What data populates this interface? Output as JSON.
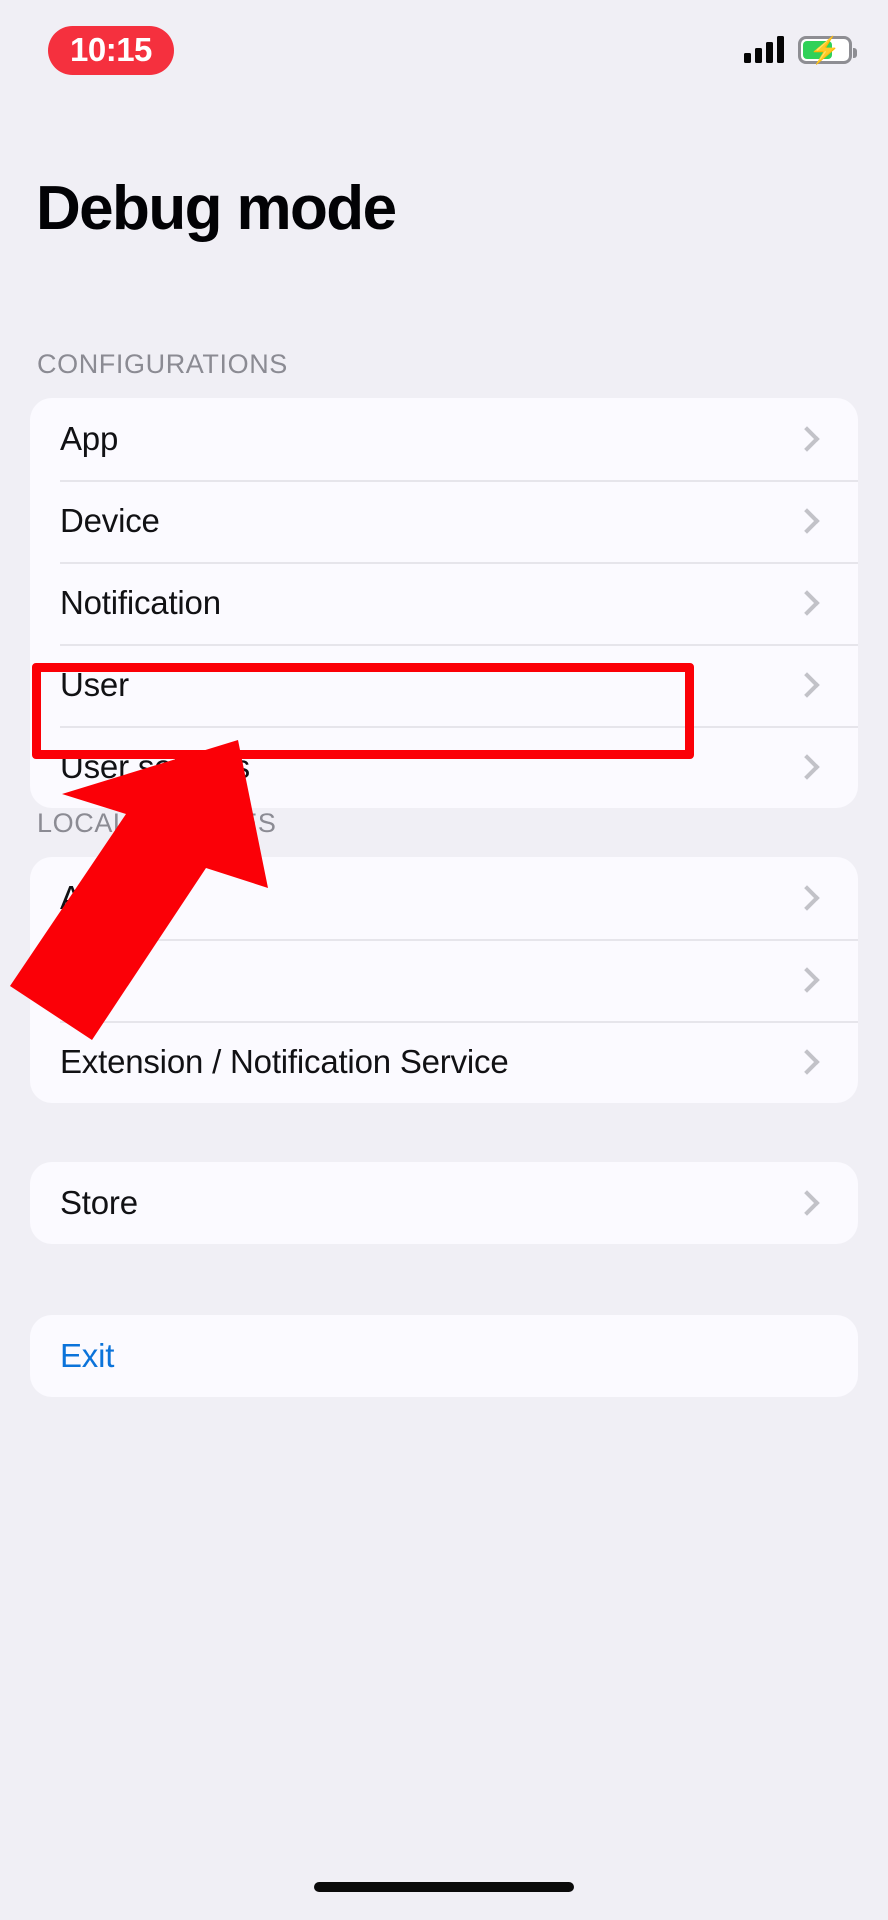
{
  "status_bar": {
    "time": "10:15",
    "time_pill_color": "#f5303e",
    "signal_icon": "cellular-signal-icon",
    "battery_icon": "battery-charging-icon",
    "battery_level_percent": 60
  },
  "header": {
    "title": "Debug mode"
  },
  "sections": [
    {
      "id": "configurations",
      "header": "CONFIGURATIONS",
      "rows": [
        {
          "label": "App",
          "accessory": "chevron-right-icon"
        },
        {
          "label": "Device",
          "accessory": "chevron-right-icon"
        },
        {
          "label": "Notification",
          "accessory": "chevron-right-icon"
        },
        {
          "label": "User",
          "accessory": "chevron-right-icon"
        },
        {
          "label": "User settings",
          "accessory": "chevron-right-icon",
          "highlighted": true
        }
      ]
    },
    {
      "id": "local_services",
      "header": "LOCAL SERVICES",
      "rows": [
        {
          "label": "App",
          "accessory": "chevron-right-icon",
          "obscured_by_arrow": true
        },
        {
          "label": "",
          "accessory": "chevron-right-icon",
          "obscured_by_arrow": true
        },
        {
          "label": "Extension / Notification Service",
          "accessory": "chevron-right-icon"
        }
      ]
    },
    {
      "id": "store",
      "header": "",
      "rows": [
        {
          "label": "Store",
          "accessory": "chevron-right-icon"
        }
      ]
    },
    {
      "id": "exit",
      "header": "",
      "rows": [
        {
          "label": "Exit",
          "accessory": "none",
          "style": "link"
        }
      ]
    }
  ],
  "annotation": {
    "highlight_color": "#fb0007",
    "highlight_target": "User settings",
    "arrow_color": "#fb0007",
    "arrow_icon": "pointer-arrow-icon"
  }
}
